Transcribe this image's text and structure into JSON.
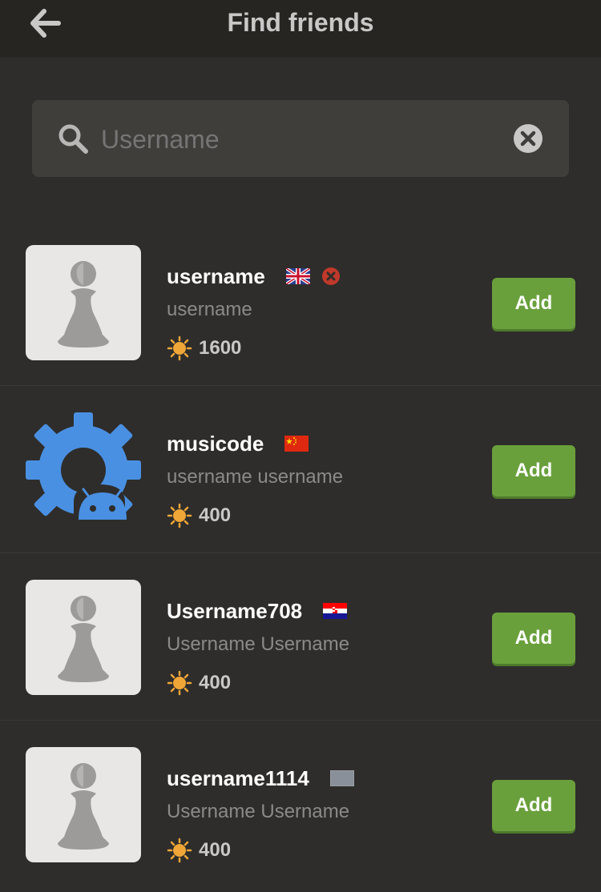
{
  "header": {
    "title": "Find friends",
    "back_icon": "arrow-left-icon"
  },
  "search": {
    "placeholder": "Username",
    "value": ""
  },
  "colors": {
    "accent_green": "#6aa03c",
    "background": "#2e2d2b",
    "header": "#262522",
    "status_red": "#c0392b",
    "rating_orange": "#f0a637"
  },
  "friends": [
    {
      "username": "username",
      "name": "username",
      "rating": "1600",
      "flag": "uk-flag-icon",
      "avatar": "pawn-icon",
      "status": "not-online-icon",
      "add_label": "Add"
    },
    {
      "username": "musicode",
      "name": "username username",
      "rating": "400",
      "flag": "china-flag-icon",
      "avatar": "gear-android-icon",
      "status": "",
      "add_label": "Add"
    },
    {
      "username": "Username708",
      "name": "Username Username",
      "rating": "400",
      "flag": "croatia-flag-icon",
      "avatar": "pawn-icon",
      "status": "",
      "add_label": "Add"
    },
    {
      "username": "username1114",
      "name": "Username Username",
      "rating": "400",
      "flag": "gray-flag-icon",
      "avatar": "pawn-icon",
      "status": "",
      "add_label": "Add"
    }
  ]
}
